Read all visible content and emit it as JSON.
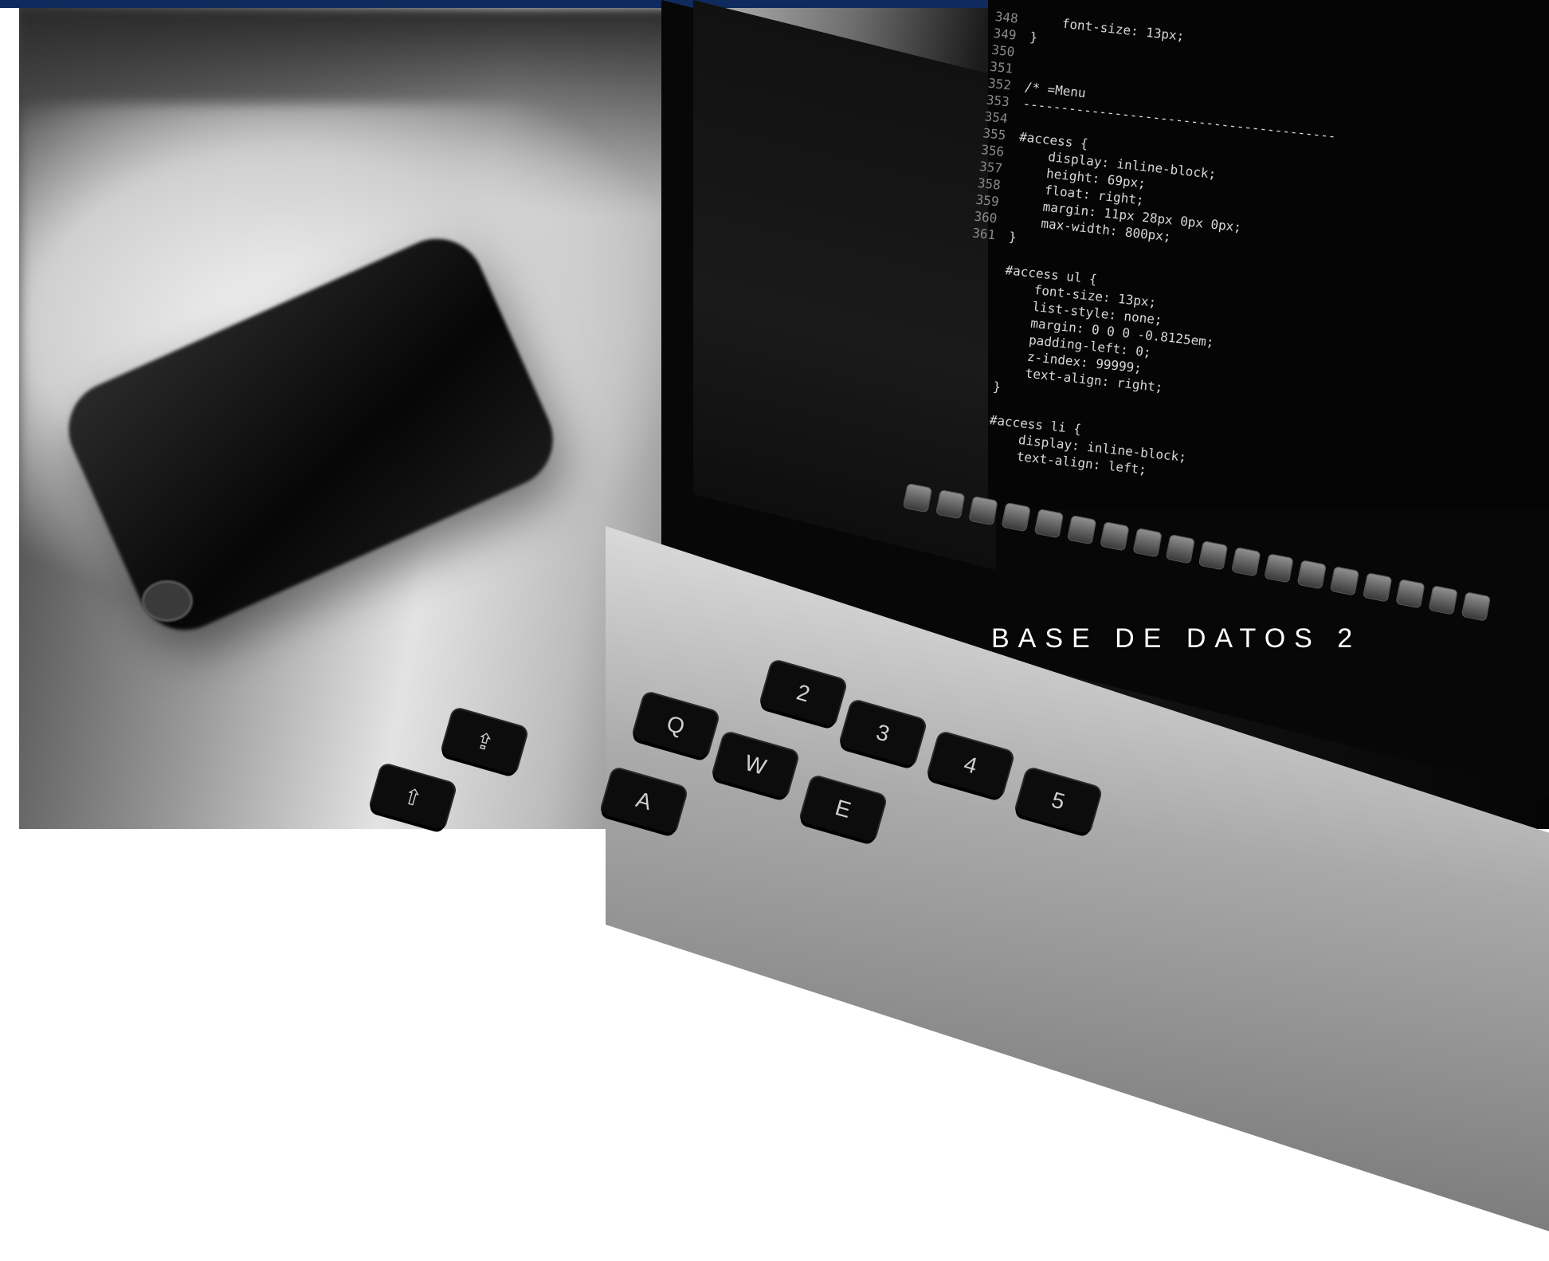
{
  "colors": {
    "top_bar": "#0f2a5c",
    "title_text": "#ffffff",
    "photo_tone": "grayscale"
  },
  "banner": {
    "title": "BASE DE DATOS 2"
  },
  "photo": {
    "code_lines": [
      {
        "num": "348",
        "text": "    font-size: 13px;"
      },
      {
        "num": "349",
        "text": "}"
      },
      {
        "num": "350",
        "text": ""
      },
      {
        "num": "351",
        "text": ""
      },
      {
        "num": "352",
        "text": "/* =Menu"
      },
      {
        "num": "353",
        "text": "-----------------------------------------"
      },
      {
        "num": "354",
        "text": ""
      },
      {
        "num": "355",
        "text": "#access {"
      },
      {
        "num": "356",
        "text": "    display: inline-block;"
      },
      {
        "num": "357",
        "text": "    height: 69px;"
      },
      {
        "num": "358",
        "text": "    float: right;"
      },
      {
        "num": "359",
        "text": "    margin: 11px 28px 0px 0px;"
      },
      {
        "num": "360",
        "text": "    max-width: 800px;"
      },
      {
        "num": "361",
        "text": "}"
      },
      {
        "num": "",
        "text": ""
      },
      {
        "num": "",
        "text": "#access ul {"
      },
      {
        "num": "",
        "text": "    font-size: 13px;"
      },
      {
        "num": "",
        "text": "    list-style: none;"
      },
      {
        "num": "",
        "text": "    margin: 0 0 0 -0.8125em;"
      },
      {
        "num": "",
        "text": "    padding-left: 0;"
      },
      {
        "num": "",
        "text": "    z-index: 99999;"
      },
      {
        "num": "",
        "text": "    text-align: right;"
      },
      {
        "num": "",
        "text": "}"
      },
      {
        "num": "",
        "text": ""
      },
      {
        "num": "",
        "text": "#access li {"
      },
      {
        "num": "",
        "text": "    display: inline-block;"
      },
      {
        "num": "",
        "text": "    text-align: left;"
      }
    ],
    "keys": [
      {
        "label": "⇧"
      },
      {
        "label": "⇪"
      },
      {
        "label": "A"
      },
      {
        "label": "Q"
      },
      {
        "label": "W"
      },
      {
        "label": "E"
      },
      {
        "label": "2"
      },
      {
        "label": "3"
      },
      {
        "label": "4"
      },
      {
        "label": "5"
      }
    ]
  }
}
